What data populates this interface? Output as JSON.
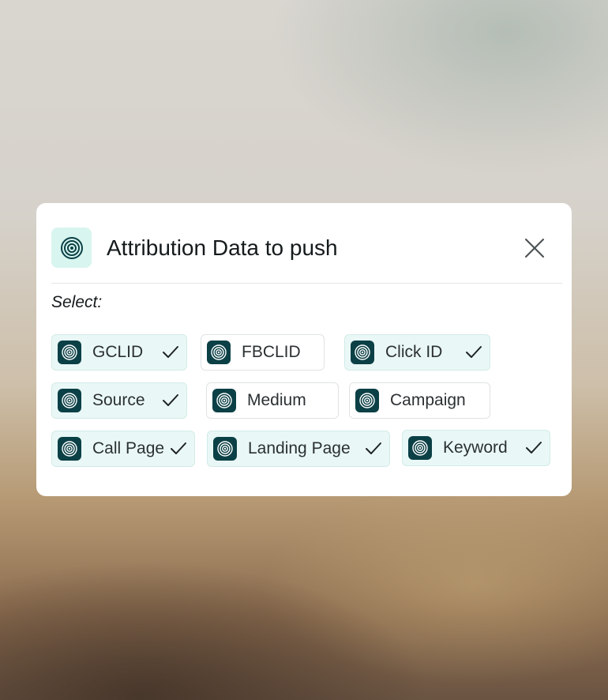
{
  "modal": {
    "title": "Attribution Data to push",
    "header_icon": "target-icon",
    "close_icon": "close-icon",
    "select_label": "Select:"
  },
  "options": [
    {
      "label": "GCLID",
      "selected": true,
      "icon": "target-icon"
    },
    {
      "label": "FBCLID",
      "selected": false,
      "icon": "target-icon"
    },
    {
      "label": "Click ID",
      "selected": true,
      "icon": "target-icon"
    },
    {
      "label": "Source",
      "selected": true,
      "icon": "target-icon"
    },
    {
      "label": "Medium",
      "selected": false,
      "icon": "target-icon"
    },
    {
      "label": "Campaign",
      "selected": false,
      "icon": "target-icon"
    },
    {
      "label": "Call Page",
      "selected": true,
      "icon": "target-icon"
    },
    {
      "label": "Landing Page",
      "selected": true,
      "icon": "target-icon"
    },
    {
      "label": "Keyword",
      "selected": true,
      "icon": "target-icon"
    }
  ],
  "colors": {
    "accent_dark": "#0b4046",
    "chip_selected_bg": "#e9f8f6",
    "header_icon_bg": "#d8f5ef"
  }
}
